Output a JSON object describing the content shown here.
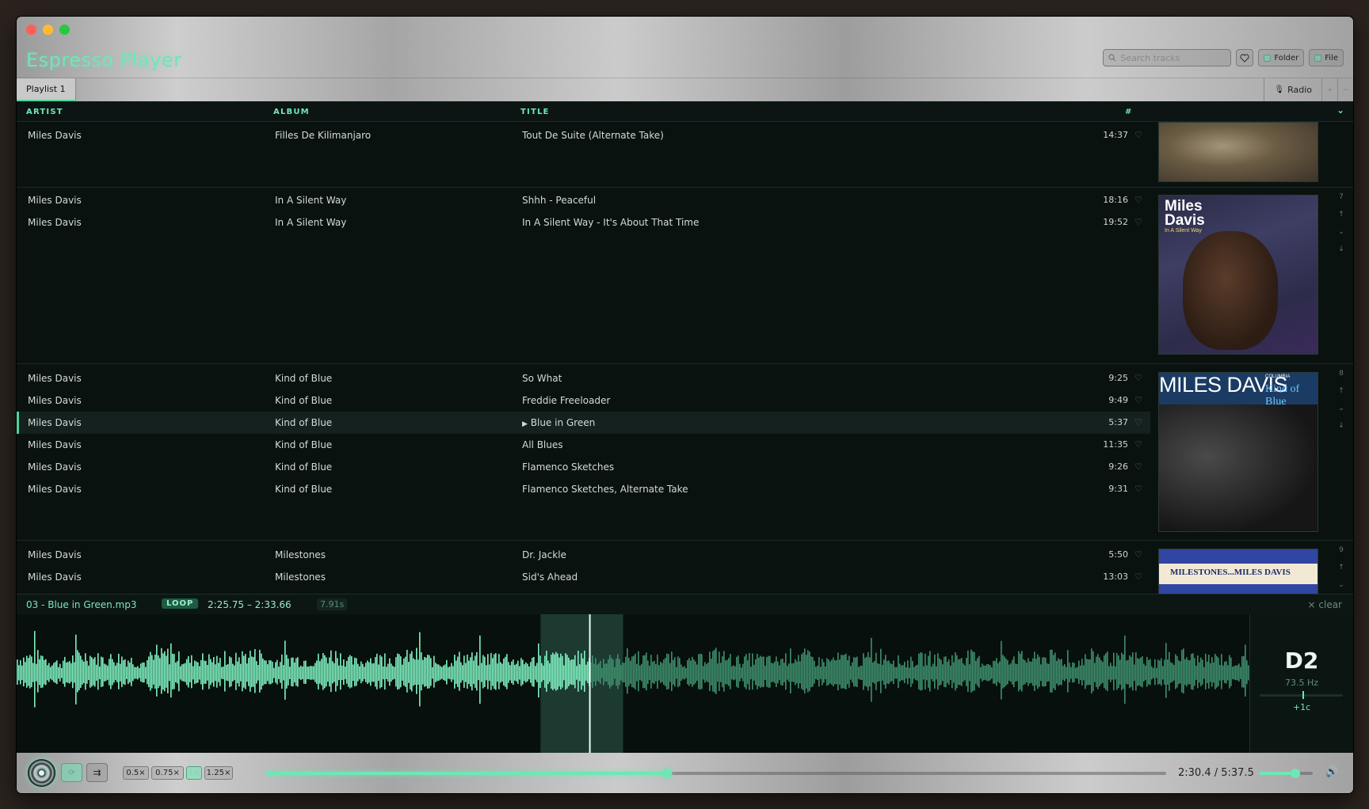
{
  "app": {
    "title": "Espresso Player"
  },
  "header": {
    "search_placeholder": "Search tracks",
    "folder_label": "Folder",
    "file_label": "File"
  },
  "tabs": {
    "playlist": "Playlist 1",
    "radio": "Radio"
  },
  "columns": {
    "artist": "ARTIST",
    "album": "ALBUM",
    "title": "TITLE",
    "num": "#"
  },
  "groups": [
    {
      "index": "",
      "album_art": "Filles De Kilimanjaro",
      "tracks": [
        {
          "artist": "Miles Davis",
          "album": "Filles De Kilimanjaro",
          "title": "Tout De Suite (Alternate Take)",
          "duration": "14:37"
        }
      ]
    },
    {
      "index": "7",
      "album_art": "In A Silent Way",
      "tracks": [
        {
          "artist": "Miles Davis",
          "album": "In A Silent Way",
          "title": "Shhh - Peaceful",
          "duration": "18:16"
        },
        {
          "artist": "Miles Davis",
          "album": "In A Silent Way",
          "title": "In A Silent Way - It's About That Time",
          "duration": "19:52"
        }
      ]
    },
    {
      "index": "8",
      "album_art": "Kind of Blue",
      "tracks": [
        {
          "artist": "Miles Davis",
          "album": "Kind of Blue",
          "title": "So What",
          "duration": "9:25"
        },
        {
          "artist": "Miles Davis",
          "album": "Kind of Blue",
          "title": "Freddie Freeloader",
          "duration": "9:49"
        },
        {
          "artist": "Miles Davis",
          "album": "Kind of Blue",
          "title": "Blue in Green",
          "duration": "5:37",
          "playing": true
        },
        {
          "artist": "Miles Davis",
          "album": "Kind of Blue",
          "title": "All Blues",
          "duration": "11:35"
        },
        {
          "artist": "Miles Davis",
          "album": "Kind of Blue",
          "title": "Flamenco Sketches",
          "duration": "9:26"
        },
        {
          "artist": "Miles Davis",
          "album": "Kind of Blue",
          "title": "Flamenco Sketches, Alternate Take",
          "duration": "9:31"
        }
      ]
    },
    {
      "index": "9",
      "album_art": "Milestones",
      "tracks": [
        {
          "artist": "Miles Davis",
          "album": "Milestones",
          "title": "Dr. Jackle",
          "duration": "5:50"
        },
        {
          "artist": "Miles Davis",
          "album": "Milestones",
          "title": "Sid's Ahead",
          "duration": "13:03"
        }
      ]
    }
  ],
  "album_art_text": {
    "silent_way_title": "Miles Davis",
    "silent_way_sub": "In A Silent Way",
    "kob_artist": "MILES DAVIS",
    "kob_title": "Kind of Blue",
    "kob_label": "COLUMBIA",
    "milestones_title": "MILESTONES...MILES DAVIS"
  },
  "now_playing": {
    "file": "03 - Blue in Green.mp3",
    "loop_label": "LOOP",
    "loop_range": "2:25.75 – 2:33.66",
    "loop_length": "7.91s",
    "clear_label": "× clear",
    "loop_start_fraction": 0.425,
    "loop_end_fraction": 0.492,
    "playhead_fraction": 0.465
  },
  "tuner": {
    "note": "D2",
    "frequency": "73.5 Hz",
    "cents": "+1c",
    "needle_fraction": 0.51
  },
  "transport": {
    "speeds": [
      "0.5×",
      "0.75×",
      "1×",
      "1.25×"
    ],
    "active_speed": "1×",
    "time": "2:30.4 / 5:37.5",
    "progress_fraction": 0.446,
    "volume_fraction": 0.68
  },
  "colors": {
    "accent": "#6ee7b7",
    "background": "#0a1210"
  }
}
